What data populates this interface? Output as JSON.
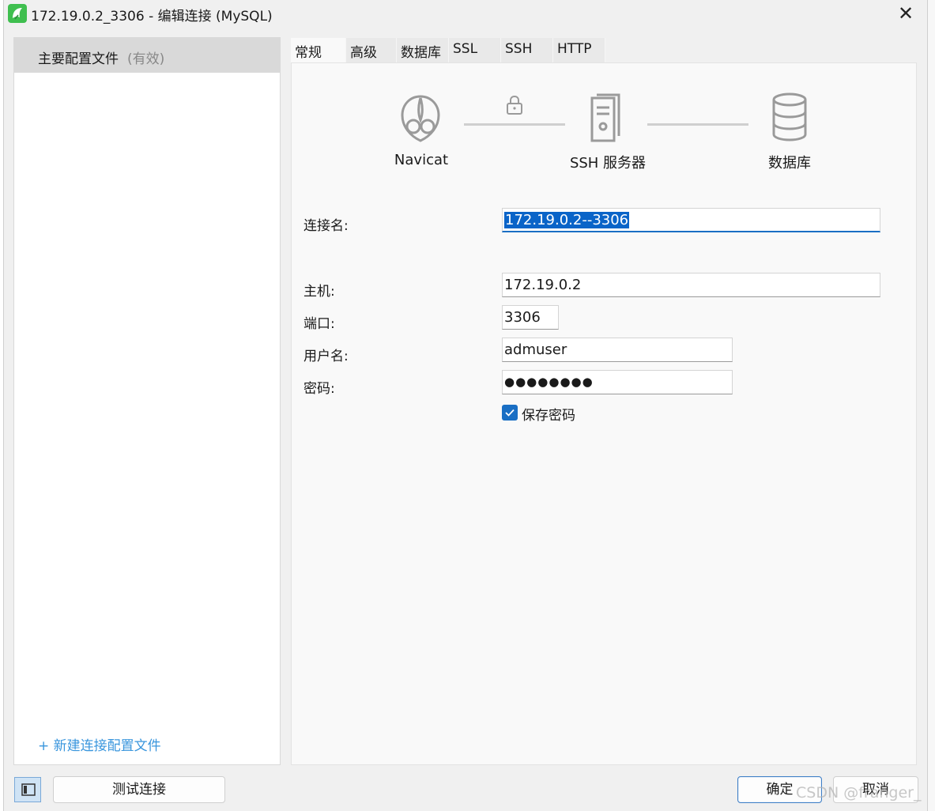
{
  "window": {
    "title": "172.19.0.2_3306 - 编辑连接 (MySQL)",
    "close_glyph": "✕"
  },
  "sidebar": {
    "profiles": [
      {
        "name": "主要配置文件",
        "status": "(有效)"
      }
    ],
    "new_profile_link": "+ 新建连接配置文件"
  },
  "tabs": [
    {
      "label": "常规",
      "active": true
    },
    {
      "label": "高级",
      "active": false
    },
    {
      "label": "数据库",
      "active": false
    },
    {
      "label": "SSL",
      "active": false
    },
    {
      "label": "SSH",
      "active": false
    },
    {
      "label": "HTTP",
      "active": false
    }
  ],
  "diagram": {
    "nodes": [
      {
        "label": "Navicat",
        "icon": "navicat-logo-icon"
      },
      {
        "label": "SSH 服务器",
        "icon": "server-icon"
      },
      {
        "label": "数据库",
        "icon": "database-icon"
      }
    ],
    "link_icon": "lock-icon"
  },
  "form": {
    "connection_name": {
      "label": "连接名:",
      "value": "172.19.0.2--3306"
    },
    "host": {
      "label": "主机:",
      "value": "172.19.0.2"
    },
    "port": {
      "label": "端口:",
      "value": "3306"
    },
    "username": {
      "label": "用户名:",
      "value": "admuser"
    },
    "password": {
      "label": "密码:",
      "value": "●●●●●●●●"
    },
    "save_password": {
      "label": "保存密码",
      "checked": true
    }
  },
  "footer": {
    "test_button": "测试连接",
    "ok_button": "确定",
    "cancel_button": "取消"
  },
  "watermark": "CSDN @franger_",
  "colors": {
    "accent": "#1a6fc4",
    "link": "#3a96dd",
    "selection": "#0a64c8",
    "app_icon": "#3fbf4f"
  }
}
